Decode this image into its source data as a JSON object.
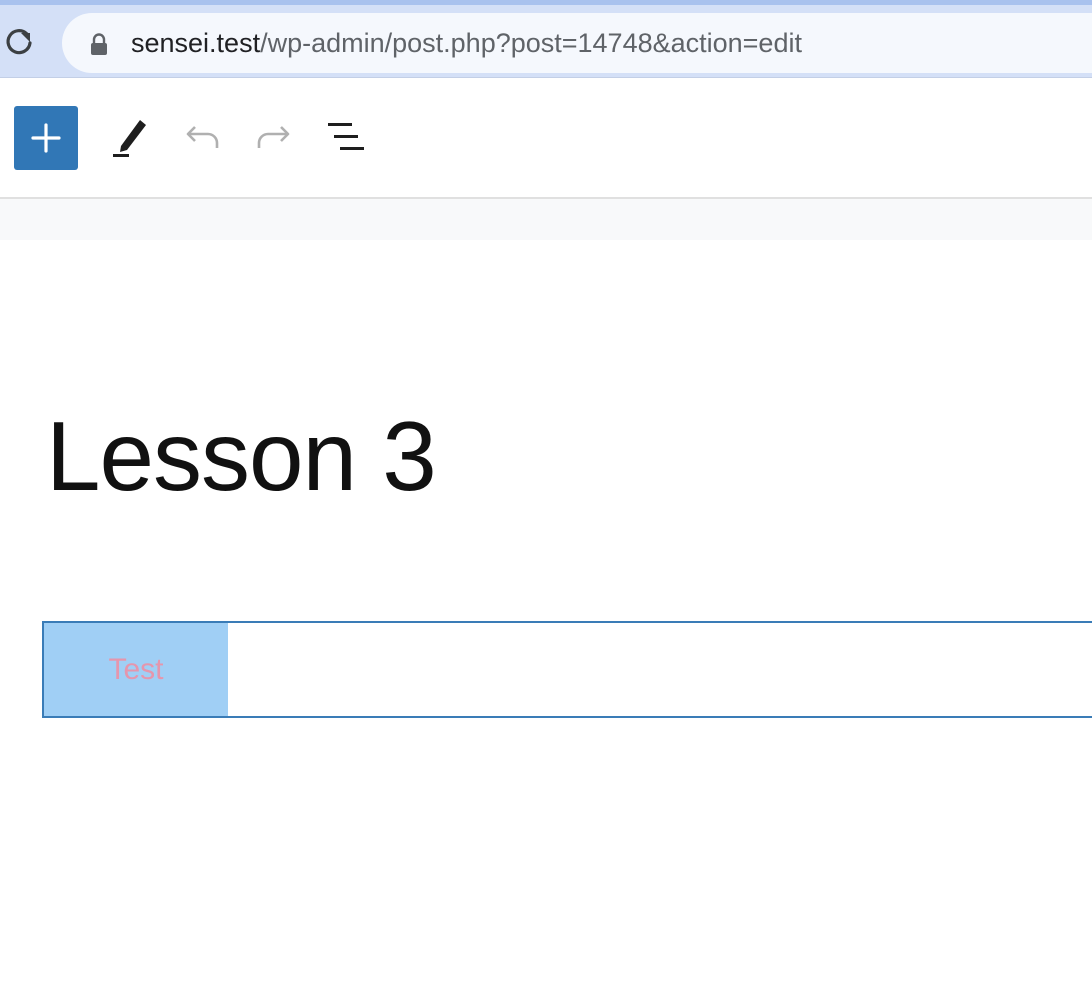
{
  "browser": {
    "url_host": "sensei.test",
    "url_path": "/wp-admin/post.php?post=14748&action=edit",
    "icons": [
      "reload-icon",
      "lock-icon"
    ]
  },
  "toolbar": {
    "icons": [
      "plus-icon",
      "pencil-icon",
      "undo-icon",
      "redo-icon",
      "list-view-icon"
    ],
    "colors": {
      "inserter_bg": "#3177b6",
      "disabled_icon": "#b0b0b0",
      "active_icon": "#1e1e1e"
    }
  },
  "content": {
    "title": "Lesson 3",
    "block_tab_label": "Test"
  },
  "colors": {
    "block_border": "#3a7cb7",
    "tab_bg": "#a0cff5",
    "tab_text": "#e596ad"
  }
}
